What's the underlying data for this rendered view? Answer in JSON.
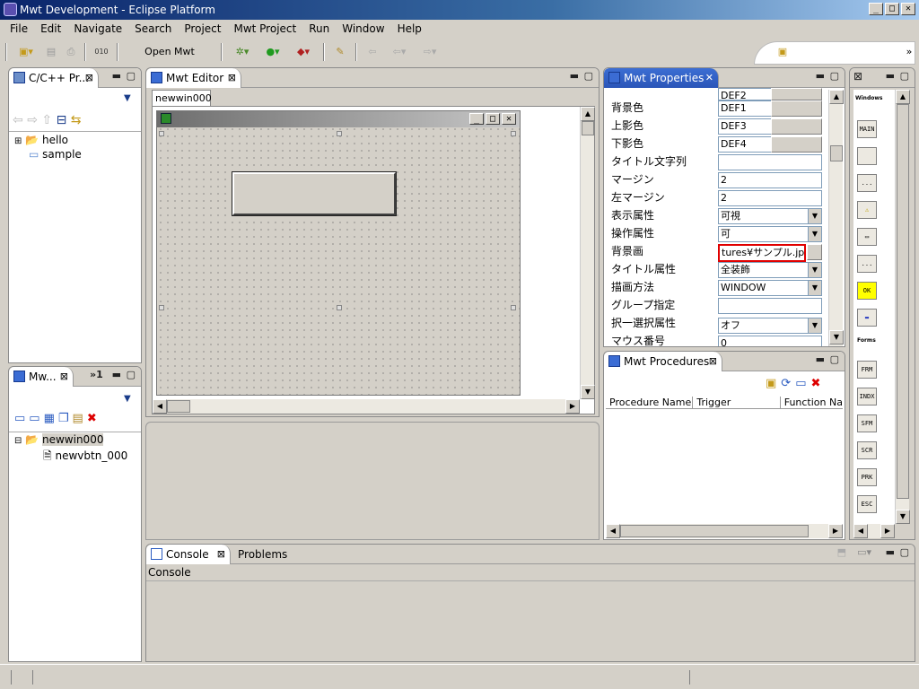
{
  "window": {
    "title": "Mwt Development - Eclipse Platform",
    "controls": [
      "_",
      "□",
      "✕"
    ]
  },
  "menu": [
    "File",
    "Edit",
    "Navigate",
    "Search",
    "Project",
    "Mwt Project",
    "Run",
    "Window",
    "Help"
  ],
  "toolbar": {
    "open_mwt_window": "Open Mwt Window"
  },
  "cpp_panel": {
    "tab": "C/C++ Pr...",
    "tree": [
      "hello",
      "sample"
    ]
  },
  "mwt_panel": {
    "tab": "Mw...",
    "overflow": "»1",
    "tree_root": "newwin000",
    "tree_child": "newvbtn_000"
  },
  "editor": {
    "tab": "Mwt Editor",
    "subtab": "newwin000"
  },
  "properties": {
    "tab": "Mwt Properties",
    "top_value": "DEF2",
    "rows": [
      {
        "label": "背景色",
        "value": "DEF1"
      },
      {
        "label": "上影色",
        "value": "DEF3"
      },
      {
        "label": "下影色",
        "value": "DEF4"
      },
      {
        "label": "タイトル文字列",
        "value": ""
      },
      {
        "label": "マージン",
        "value": "2"
      },
      {
        "label": "左マージン",
        "value": "2"
      },
      {
        "label": "表示属性",
        "value": "可視"
      },
      {
        "label": "操作属性",
        "value": "可"
      },
      {
        "label": "背景画",
        "value": "tures¥サンプル.jpg"
      },
      {
        "label": "タイトル属性",
        "value": "全装飾"
      },
      {
        "label": "描画方法",
        "value": "WINDOW"
      },
      {
        "label": "グループ指定",
        "value": ""
      },
      {
        "label": "択一選択属性",
        "value": "オフ"
      },
      {
        "label": "マウス番号",
        "value": "0"
      }
    ]
  },
  "procedures": {
    "tab": "Mwt Procedures",
    "columns": [
      "Procedure Name",
      "Trigger",
      "Function Na"
    ]
  },
  "palette": {
    "windows_label": "Windows",
    "forms_label": "Forms",
    "window_items": [
      "MAIN",
      "",
      "...",
      "⚠",
      "▭",
      "...",
      "OK",
      "▬"
    ],
    "form_items": [
      "FRM",
      "INDX",
      "SFM",
      "SCR",
      "PRK",
      "ESC"
    ]
  },
  "console": {
    "tab": "Console",
    "tab2": "Problems",
    "text": "Console"
  }
}
